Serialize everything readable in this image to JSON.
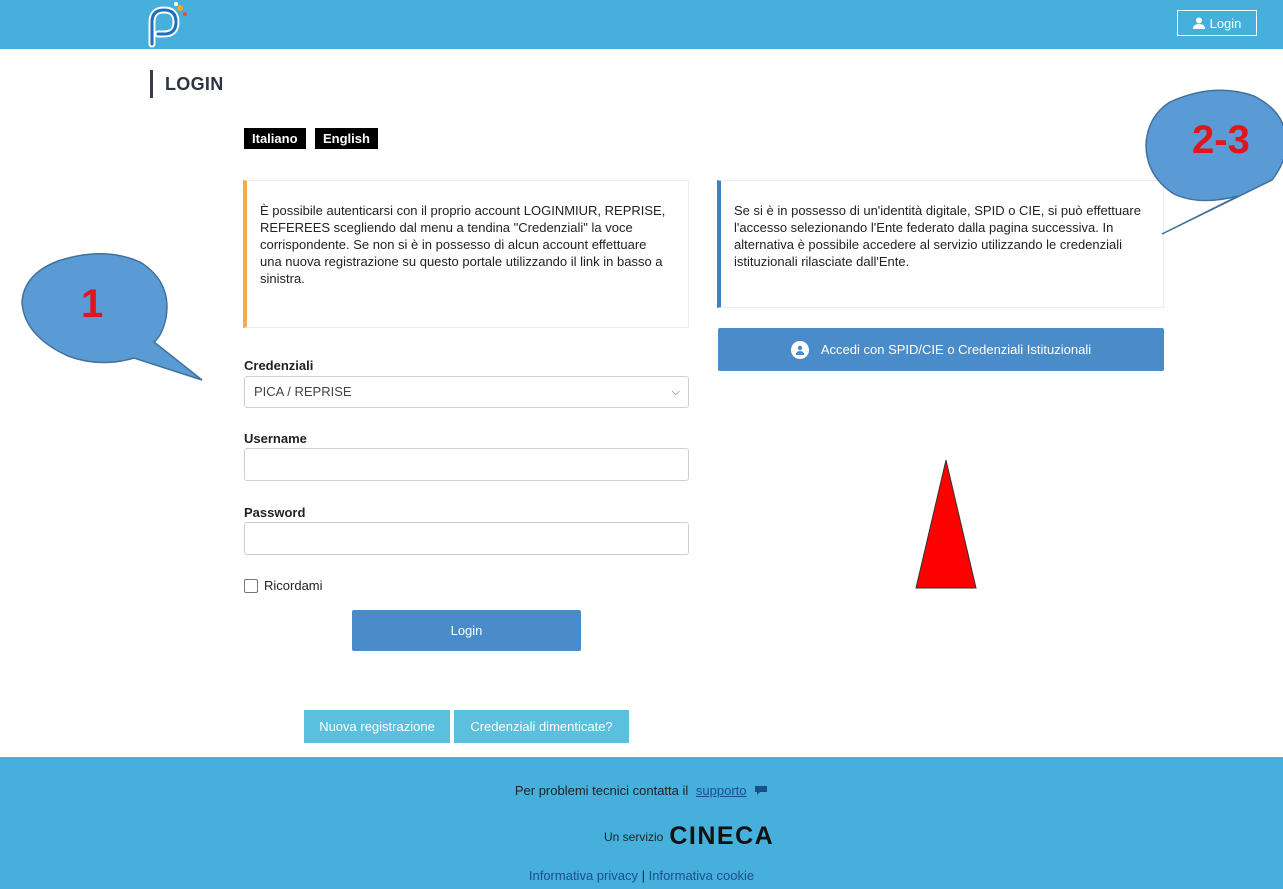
{
  "header": {
    "login_label": "Login"
  },
  "page": {
    "title": "LOGIN"
  },
  "languages": [
    "Italiano",
    "English"
  ],
  "left_info": "È possibile autenticarsi con il proprio account LOGINMIUR, REPRISE, REFEREES scegliendo dal menu a tendina \"Credenziali\" la voce corrispondente. Se non si è in possesso di alcun account effettuare una nuova registrazione su questo portale utilizzando il link in basso a sinistra.",
  "right_info": "Se si è in possesso di un'identità digitale, SPID o CIE, si può effettuare l'accesso selezionando l'Ente federato dalla pagina successiva. In alternativa è possibile accedere al servizio utilizzando le credenziali istituzionali rilasciate dall'Ente.",
  "spid_button": "Accedi con SPID/CIE o Credenziali Istituzionali",
  "form": {
    "credentials_label": "Credenziali",
    "credentials_value": "PICA / REPRISE",
    "username_label": "Username",
    "username_value": "",
    "password_label": "Password",
    "password_value": "",
    "remember_label": "Ricordami",
    "login_button": "Login"
  },
  "actions": {
    "register": "Nuova registrazione",
    "forgot": "Credenziali dimenticate?"
  },
  "footer": {
    "support_text": "Per problemi tecnici contatta il",
    "support_link": "supporto",
    "service_text": "Un servizio",
    "brand": "CINECA",
    "privacy": "Informativa privacy",
    "separator": "|",
    "cookie": "Informativa cookie"
  },
  "annotations": {
    "callout_1": "1",
    "callout_2": "2-3"
  },
  "colors": {
    "topbar": "#46afdc",
    "primary_button": "#4a8bc9",
    "secondary_button": "#5bc0de",
    "warning_border": "#f0ad4e",
    "callout_fill": "#5b9bd5",
    "callout_text": "#e3141e",
    "arrow": "#ff0000"
  }
}
